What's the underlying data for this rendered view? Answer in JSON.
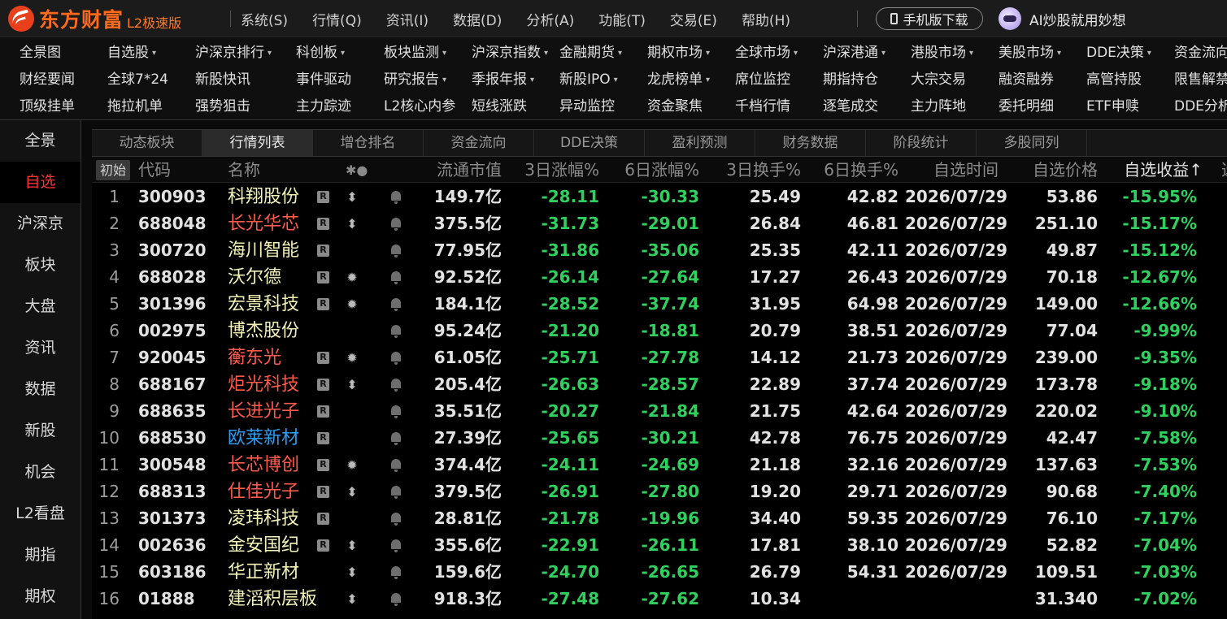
{
  "app": {
    "logo_text": "东方财富",
    "logo_sub": "L2极速版",
    "menu": [
      "系统(S)",
      "行情(Q)",
      "资讯(I)",
      "数据(D)",
      "分析(A)",
      "功能(T)",
      "交易(E)",
      "帮助(H)"
    ],
    "mobile_download": "手机版下载",
    "ai_label": "AI炒股就用妙想"
  },
  "nav": {
    "rows": [
      [
        {
          "label": "全景图",
          "caret": false
        },
        {
          "label": "自选股",
          "caret": true
        },
        {
          "label": "沪深京排行",
          "caret": true
        },
        {
          "label": "科创板",
          "caret": true
        },
        {
          "label": "板块监测",
          "caret": true
        },
        {
          "label": "沪深京指数",
          "caret": true
        },
        {
          "label": "金融期货",
          "caret": true
        },
        {
          "label": "期权市场",
          "caret": true
        },
        {
          "label": "全球市场",
          "caret": true
        },
        {
          "label": "沪深港通",
          "caret": true
        },
        {
          "label": "港股市场",
          "caret": true
        },
        {
          "label": "美股市场",
          "caret": true
        },
        {
          "label": "DDE决策",
          "caret": true
        },
        {
          "label": "资金流向",
          "caret": false
        }
      ],
      [
        {
          "label": "财经要闻",
          "caret": false
        },
        {
          "label": "全球7*24",
          "caret": false
        },
        {
          "label": "新股快讯",
          "caret": false
        },
        {
          "label": "事件驱动",
          "caret": false
        },
        {
          "label": "研究报告",
          "caret": true
        },
        {
          "label": "季报年报",
          "caret": true
        },
        {
          "label": "新股IPO",
          "caret": true
        },
        {
          "label": "龙虎榜单",
          "caret": true
        },
        {
          "label": "席位监控",
          "caret": false
        },
        {
          "label": "期指持仓",
          "caret": false
        },
        {
          "label": "大宗交易",
          "caret": false
        },
        {
          "label": "融资融券",
          "caret": false
        },
        {
          "label": "高管持股",
          "caret": false
        },
        {
          "label": "限售解禁",
          "caret": false
        }
      ],
      [
        {
          "label": "顶级挂单",
          "caret": false
        },
        {
          "label": "拖拉机单",
          "caret": false
        },
        {
          "label": "强势狙击",
          "caret": false
        },
        {
          "label": "主力踪迹",
          "caret": false
        },
        {
          "label": "L2核心内参",
          "caret": false
        },
        {
          "label": "短线涨跌",
          "caret": false
        },
        {
          "label": "异动监控",
          "caret": false
        },
        {
          "label": "资金聚焦",
          "caret": false
        },
        {
          "label": "千档行情",
          "caret": false
        },
        {
          "label": "逐笔成交",
          "caret": false
        },
        {
          "label": "主力阵地",
          "caret": false
        },
        {
          "label": "委托明细",
          "caret": false
        },
        {
          "label": "ETF申赎",
          "caret": false
        },
        {
          "label": "DDE分析",
          "caret": false
        }
      ]
    ]
  },
  "sidebar": {
    "items": [
      "全景",
      "自选",
      "沪深京",
      "板块",
      "大盘",
      "资讯",
      "数据",
      "新股",
      "机会",
      "L2看盘",
      "期指",
      "期权"
    ],
    "active_index": 1
  },
  "tabs": {
    "items": [
      "动态板块",
      "行情列表",
      "增仓排名",
      "资金流向",
      "DDE决策",
      "盈利预测",
      "财务数据",
      "阶段统计",
      "多股同列"
    ],
    "active_index": 1
  },
  "table": {
    "init_label": "初始",
    "headers": {
      "code": "代码",
      "name": "名称",
      "flags": "✱●",
      "mcap": "流通市值",
      "r3": "3日涨幅%",
      "r6": "6日涨幅%",
      "t3": "3日换手%",
      "t6": "6日换手%",
      "date": "自选时间",
      "price": "自选价格",
      "ret": "自选收益↑",
      "edge": "选"
    },
    "r_badge": "R",
    "colors": {
      "up": "#ff3030",
      "down": "#2fd05e"
    },
    "rows": [
      {
        "idx": "1",
        "code": "300903",
        "name": "科翔股份",
        "name_color": "yellow",
        "r": true,
        "flag": "updown",
        "mcap": "149.7亿",
        "r3": "-28.11",
        "r6": "-30.33",
        "t3": "25.49",
        "t6": "42.82",
        "date": "2026/07/29",
        "price": "53.86",
        "ret": "-15.95%"
      },
      {
        "idx": "2",
        "code": "688048",
        "name": "长光华芯",
        "name_color": "red",
        "r": true,
        "flag": "updown",
        "mcap": "375.5亿",
        "r3": "-31.73",
        "r6": "-29.01",
        "t3": "26.84",
        "t6": "46.81",
        "date": "2026/07/29",
        "price": "251.10",
        "ret": "-15.17%"
      },
      {
        "idx": "3",
        "code": "300720",
        "name": "海川智能",
        "name_color": "yellow",
        "r": true,
        "flag": "",
        "mcap": "77.95亿",
        "r3": "-31.86",
        "r6": "-35.06",
        "t3": "25.35",
        "t6": "42.11",
        "date": "2026/07/29",
        "price": "49.87",
        "ret": "-15.12%"
      },
      {
        "idx": "4",
        "code": "688028",
        "name": "沃尔德",
        "name_color": "yellow",
        "r": true,
        "flag": "star",
        "mcap": "92.52亿",
        "r3": "-26.14",
        "r6": "-27.64",
        "t3": "17.27",
        "t6": "26.43",
        "date": "2026/07/29",
        "price": "70.18",
        "ret": "-12.67%"
      },
      {
        "idx": "5",
        "code": "301396",
        "name": "宏景科技",
        "name_color": "yellow",
        "r": true,
        "flag": "star",
        "mcap": "184.1亿",
        "r3": "-28.52",
        "r6": "-37.74",
        "t3": "31.95",
        "t6": "64.98",
        "date": "2026/07/29",
        "price": "149.00",
        "ret": "-12.66%"
      },
      {
        "idx": "6",
        "code": "002975",
        "name": "博杰股份",
        "name_color": "yellow",
        "r": false,
        "flag": "",
        "mcap": "95.24亿",
        "r3": "-21.20",
        "r6": "-18.81",
        "t3": "20.79",
        "t6": "38.51",
        "date": "2026/07/29",
        "price": "77.04",
        "ret": "-9.99%"
      },
      {
        "idx": "7",
        "code": "920045",
        "name": "蘅东光",
        "name_color": "red",
        "r": true,
        "flag": "star",
        "mcap": "61.05亿",
        "r3": "-25.71",
        "r6": "-27.78",
        "t3": "14.12",
        "t6": "21.73",
        "date": "2026/07/29",
        "price": "239.00",
        "ret": "-9.35%"
      },
      {
        "idx": "8",
        "code": "688167",
        "name": "炬光科技",
        "name_color": "red",
        "r": true,
        "flag": "updown",
        "mcap": "205.4亿",
        "r3": "-26.63",
        "r6": "-28.57",
        "t3": "22.89",
        "t6": "37.74",
        "date": "2026/07/29",
        "price": "173.78",
        "ret": "-9.18%"
      },
      {
        "idx": "9",
        "code": "688635",
        "name": "长进光子",
        "name_color": "red",
        "r": true,
        "flag": "",
        "mcap": "35.51亿",
        "r3": "-20.27",
        "r6": "-21.84",
        "t3": "21.75",
        "t6": "42.64",
        "date": "2026/07/29",
        "price": "220.02",
        "ret": "-9.10%"
      },
      {
        "idx": "10",
        "code": "688530",
        "name": "欧莱新材",
        "name_color": "blue",
        "r": true,
        "flag": "",
        "mcap": "27.39亿",
        "r3": "-25.65",
        "r6": "-30.21",
        "t3": "42.78",
        "t6": "76.75",
        "date": "2026/07/29",
        "price": "42.47",
        "ret": "-7.58%"
      },
      {
        "idx": "11",
        "code": "300548",
        "name": "长芯博创",
        "name_color": "red",
        "r": true,
        "flag": "star",
        "mcap": "374.4亿",
        "r3": "-24.11",
        "r6": "-24.69",
        "t3": "21.18",
        "t6": "32.16",
        "date": "2026/07/29",
        "price": "137.63",
        "ret": "-7.53%"
      },
      {
        "idx": "12",
        "code": "688313",
        "name": "仕佳光子",
        "name_color": "red",
        "r": true,
        "flag": "updown",
        "mcap": "379.5亿",
        "r3": "-26.91",
        "r6": "-27.80",
        "t3": "19.20",
        "t6": "29.71",
        "date": "2026/07/29",
        "price": "90.68",
        "ret": "-7.40%"
      },
      {
        "idx": "13",
        "code": "301373",
        "name": "凌玮科技",
        "name_color": "yellow",
        "r": true,
        "flag": "",
        "mcap": "28.81亿",
        "r3": "-21.78",
        "r6": "-19.96",
        "t3": "34.40",
        "t6": "59.35",
        "date": "2026/07/29",
        "price": "76.10",
        "ret": "-7.17%"
      },
      {
        "idx": "14",
        "code": "002636",
        "name": "金安国纪",
        "name_color": "yellow",
        "r": true,
        "flag": "updown",
        "mcap": "355.6亿",
        "r3": "-22.91",
        "r6": "-26.11",
        "t3": "17.81",
        "t6": "38.10",
        "date": "2026/07/29",
        "price": "52.82",
        "ret": "-7.04%"
      },
      {
        "idx": "15",
        "code": "603186",
        "name": "华正新材",
        "name_color": "yellow",
        "r": false,
        "flag": "updown",
        "mcap": "159.6亿",
        "r3": "-24.70",
        "r6": "-26.65",
        "t3": "26.79",
        "t6": "54.31",
        "date": "2026/07/29",
        "price": "109.51",
        "ret": "-7.03%"
      },
      {
        "idx": "16",
        "code": "01888",
        "name": "建滔积层板",
        "name_color": "yellow",
        "r": false,
        "flag": "updown",
        "mcap": "918.3亿",
        "r3": "-27.48",
        "r6": "-27.62",
        "t3": "10.34",
        "t6": "",
        "date": "",
        "price": "31.340",
        "ret": "-7.02%"
      }
    ]
  }
}
